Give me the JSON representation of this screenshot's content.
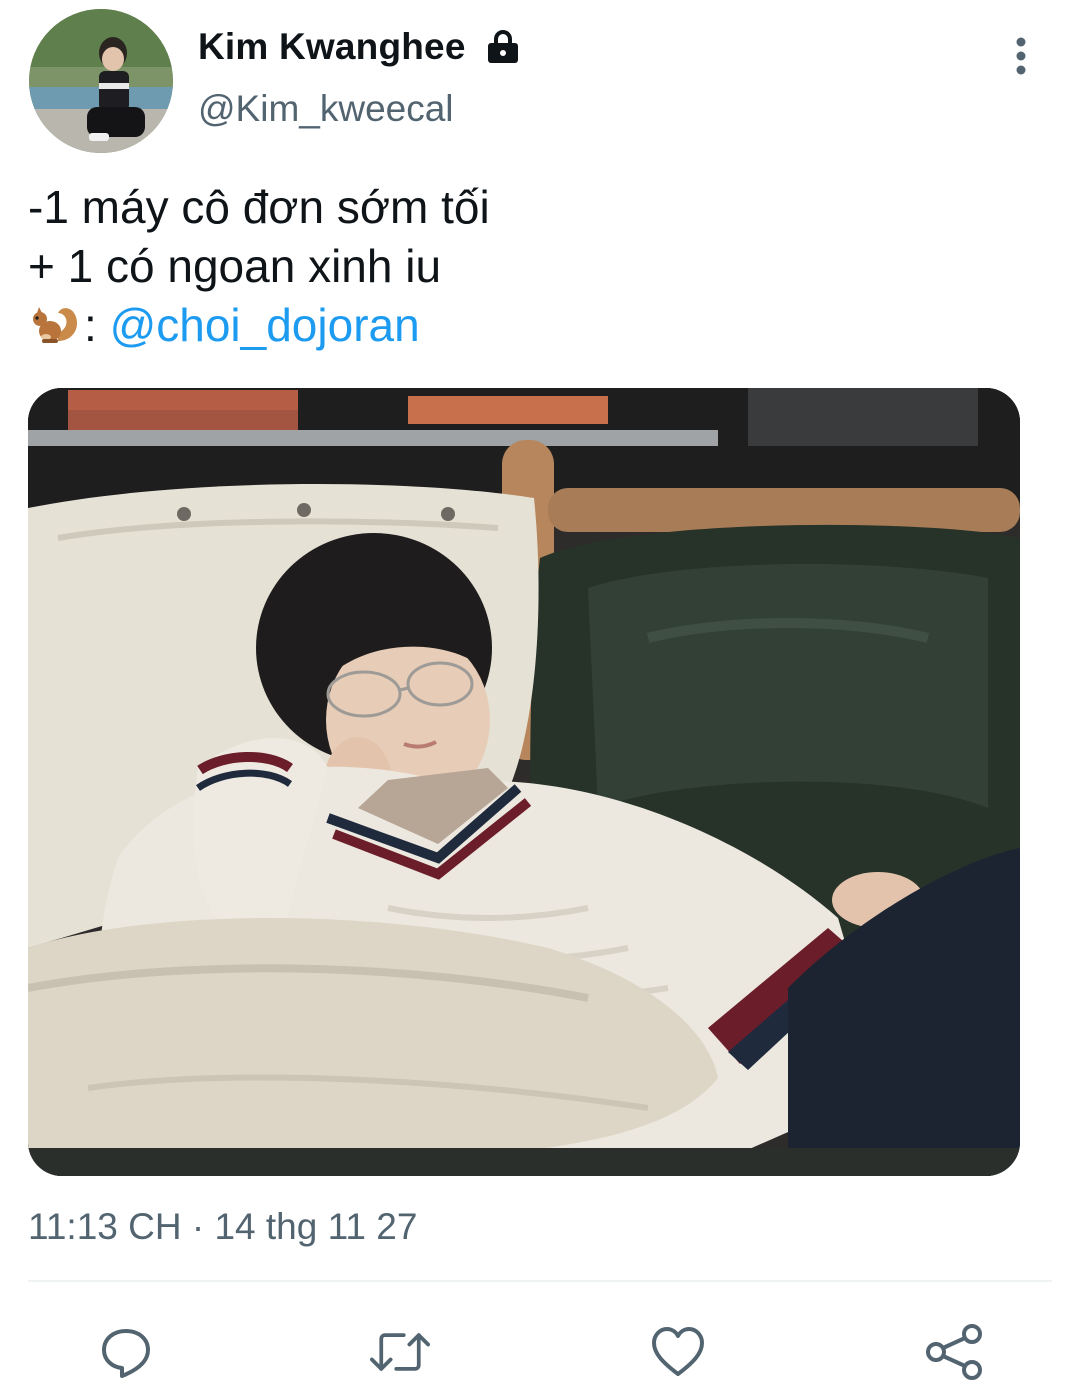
{
  "author": {
    "display_name": "Kim Kwanghee",
    "username": "@Kim_kweecal",
    "protected_icon": "lock-icon",
    "avatar": "avatar-photo"
  },
  "tweet": {
    "line1": "-1 máy cô đơn sớm tối",
    "line2": "+ 1 có ngoan xinh iu",
    "line3_emoji": "squirrel-icon",
    "line3_separator": ":",
    "mention": "@choi_dojoran",
    "media": "photo of a person in a white cable-knit sweater and glasses lounging on a sofa",
    "timestamp": "11:13 CH · 14 thg 11 27"
  },
  "actions": [
    {
      "name": "reply",
      "icon": "reply-icon"
    },
    {
      "name": "retweet",
      "icon": "retweet-icon"
    },
    {
      "name": "like",
      "icon": "heart-icon"
    },
    {
      "name": "share",
      "icon": "share-icon"
    }
  ],
  "colors": {
    "text": "#0f1419",
    "secondary": "#536471",
    "link": "#1d9bf0",
    "divider": "#eff3f4"
  }
}
